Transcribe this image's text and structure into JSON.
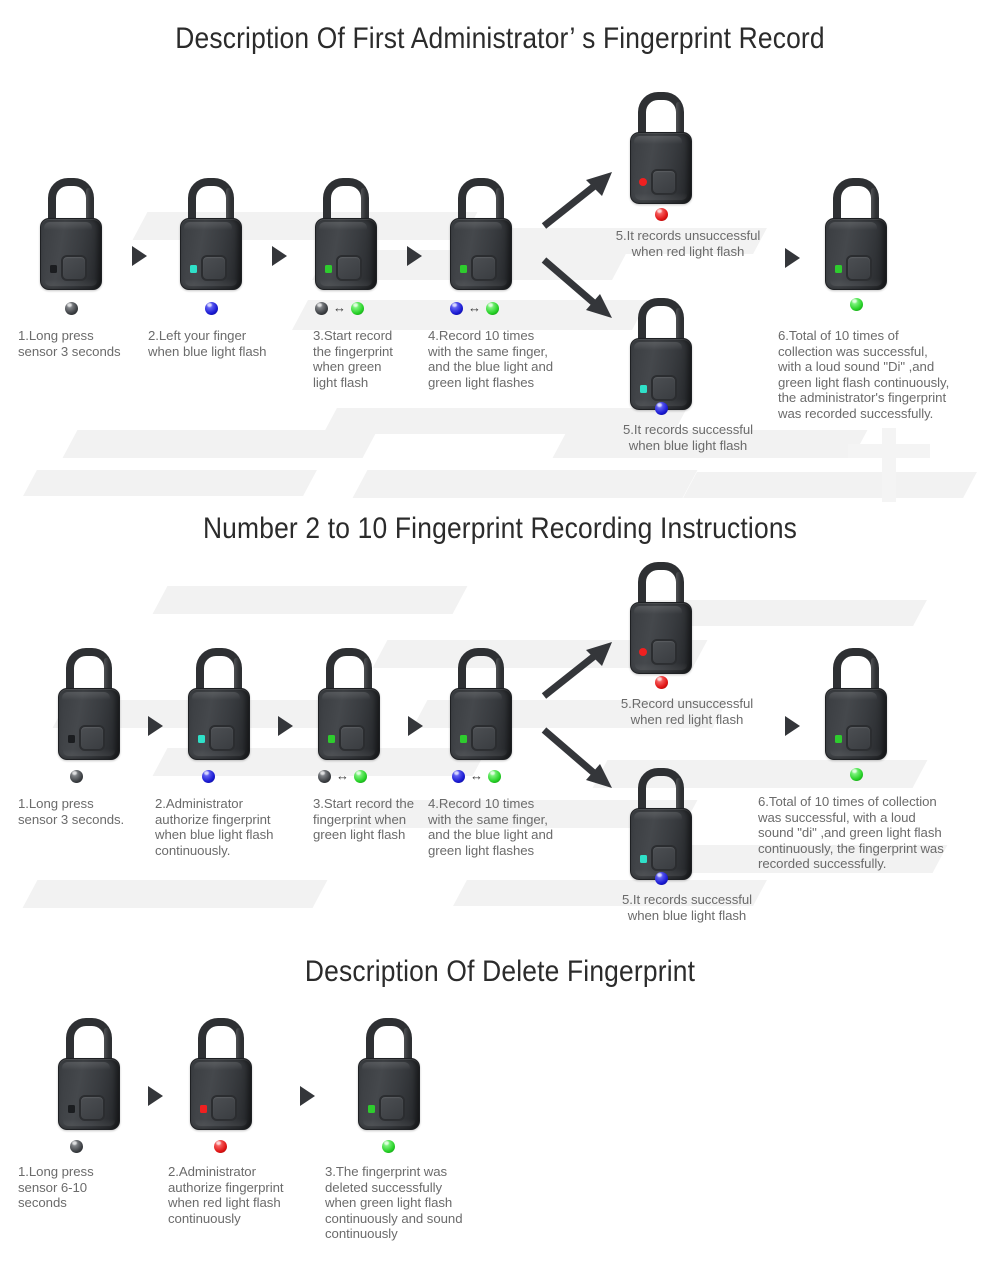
{
  "colors": {
    "led_off": "#1b1d20",
    "led_cyan": "#2fe0c8",
    "led_green": "#2ecc2e",
    "led_red": "#ef2020",
    "orb_dark": "#3f4246",
    "orb_blue": "#1a1ad2",
    "orb_green": "#25d025",
    "orb_red": "#e01414",
    "body_dark": "#3a3d41",
    "text": "#6b6b6b",
    "title": "#2b2b2b"
  },
  "sections": [
    {
      "id": "admin-record",
      "title": "Description Of First Administrator’ s Fingerprint Record",
      "steps": [
        {
          "id": "s1-step1",
          "caption": "1.Long press\nsensor 3 seconds",
          "led": "off",
          "orbs": [
            "dark"
          ]
        },
        {
          "id": "s1-step2",
          "caption": "2.Left your finger\nwhen blue light flash",
          "led": "cyan",
          "orbs": [
            "blue"
          ]
        },
        {
          "id": "s1-step3",
          "caption": "3.Start record\nthe fingerprint\nwhen green\nlight flash",
          "led": "green",
          "orbs": [
            "dark",
            "green"
          ]
        },
        {
          "id": "s1-step4",
          "caption": "4.Record 10 times\nwith the same finger,\nand the blue light and\ngreen light flashes",
          "led": "green",
          "orbs": [
            "blue",
            "green"
          ]
        },
        {
          "id": "s1-step5-fail",
          "caption": "5.It records unsuccessful\nwhen red light flash",
          "led": "red",
          "orbs": [
            "red"
          ]
        },
        {
          "id": "s1-step5-success",
          "caption": "5.It records successful\nwhen blue light flash",
          "led": "cyan",
          "orbs": [
            "blue"
          ]
        },
        {
          "id": "s1-step6",
          "caption": "6.Total of 10 times of\ncollection was successful,\nwith a loud sound \"Di\" ,and\ngreen light flash continuously,\nthe administrator's fingerprint\nwas recorded successfully.",
          "led": "green",
          "orbs": [
            "green"
          ]
        }
      ]
    },
    {
      "id": "user-record",
      "title": "Number 2 to 10 Fingerprint Recording Instructions",
      "steps": [
        {
          "id": "s2-step1",
          "caption": "1.Long press\nsensor 3 seconds.",
          "led": "off",
          "orbs": [
            "dark"
          ]
        },
        {
          "id": "s2-step2",
          "caption": "2.Administrator\nauthorize fingerprint\nwhen blue light flash\ncontinuously.",
          "led": "cyan",
          "orbs": [
            "blue"
          ]
        },
        {
          "id": "s2-step3",
          "caption": "3.Start record the\nfingerprint when\ngreen light flash",
          "led": "green",
          "orbs": [
            "dark",
            "green"
          ]
        },
        {
          "id": "s2-step4",
          "caption": "4.Record 10 times\nwith the same finger,\nand the blue light and\ngreen light flashes",
          "led": "green",
          "orbs": [
            "blue",
            "green"
          ]
        },
        {
          "id": "s2-step5-fail",
          "caption": "5.Record unsuccessful\nwhen red light flash",
          "led": "red",
          "orbs": [
            "red"
          ]
        },
        {
          "id": "s2-step5-success",
          "caption": "5.It records successful\nwhen blue light flash",
          "led": "cyan",
          "orbs": [
            "blue"
          ]
        },
        {
          "id": "s2-step6",
          "caption": "6.Total of 10 times of collection\nwas successful, with a loud\nsound \"di\" ,and green light flash\ncontinuously, the fingerprint was\n recorded successfully.",
          "led": "green",
          "orbs": [
            "green"
          ]
        }
      ]
    },
    {
      "id": "delete-fingerprint",
      "title": "Description Of Delete Fingerprint",
      "steps": [
        {
          "id": "s3-step1",
          "caption": "1.Long press\nsensor 6-10\nseconds",
          "led": "off",
          "orbs": [
            "dark"
          ]
        },
        {
          "id": "s3-step2",
          "caption": "2.Administrator\nauthorize fingerprint\nwhen red light flash\ncontinuously",
          "led": "red",
          "orbs": [
            "red"
          ]
        },
        {
          "id": "s3-step3",
          "caption": "3.The fingerprint was\ndeleted successfully\nwhen green light flash\ncontinuously and sound\ncontinuously",
          "led": "green",
          "orbs": [
            "green"
          ]
        }
      ]
    }
  ]
}
